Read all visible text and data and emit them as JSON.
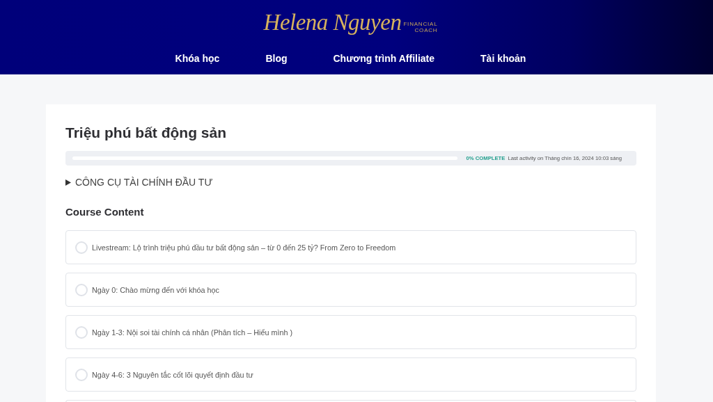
{
  "header": {
    "logo": {
      "wordmark": "Helena Nguyen",
      "tagline_1": "FINANCIAL",
      "tagline_2": "COACH"
    },
    "nav": [
      "Khóa học",
      "Blog",
      "Chương trình Affiliate",
      "Tài khoản"
    ]
  },
  "course": {
    "title": "Triệu phú bất động sản",
    "progress": {
      "level": 0,
      "status": "0% COMPLETE",
      "last_activity": "Last activity on Tháng chín 16, 2024 10:03 sáng"
    },
    "section": {
      "label": "CÔNG CỤ TÀI CHÍNH ĐẦU TƯ",
      "expanded": false
    },
    "content_heading": "Course Content",
    "lessons": [
      {
        "title": "Livestream: Lộ trình triệu phú đầu tư bất động sản – từ 0 đến 25 tỷ? From Zero to Freedom",
        "completed": false
      },
      {
        "title": "Ngày 0: Chào mừng đến với khóa học",
        "completed": false
      },
      {
        "title": "Ngày 1-3: Nội soi tài chính cá nhân (Phân tích – Hiểu mình )",
        "completed": false
      },
      {
        "title": "Ngày 4-6: 3 Nguyên tắc cốt lõi quyết định đầu tư",
        "completed": false
      }
    ],
    "more_lessons_below": true
  }
}
